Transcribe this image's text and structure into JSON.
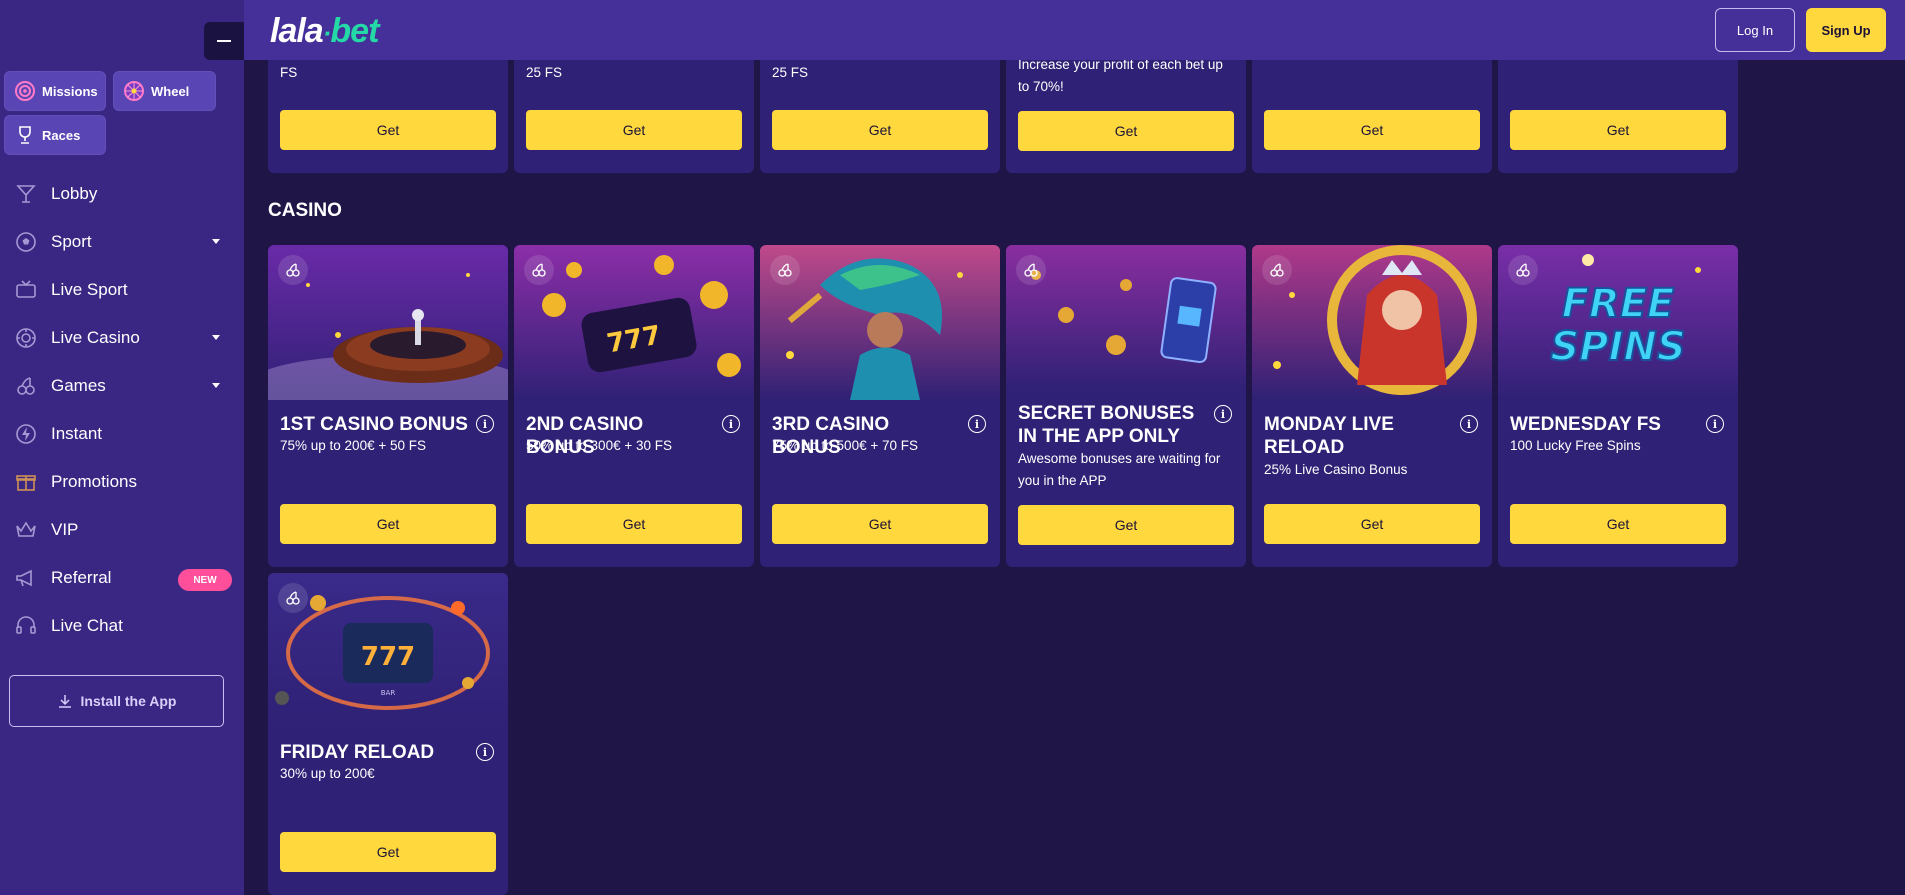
{
  "header": {
    "logo_left": "lala",
    "logo_dot": "·",
    "logo_right": "bet",
    "login_label": "Log In",
    "signup_label": "Sign Up"
  },
  "sidebar": {
    "chips": [
      {
        "label": "Missions",
        "icon": "target-icon"
      },
      {
        "label": "Wheel",
        "icon": "wheel-icon"
      },
      {
        "label": "Races",
        "icon": "trophy-icon"
      }
    ],
    "items": [
      {
        "label": "Lobby",
        "icon": "cocktail-icon"
      },
      {
        "label": "Sport",
        "icon": "football-icon"
      },
      {
        "label": "Live Sport",
        "icon": "live-tv-icon"
      },
      {
        "label": "Live Casino",
        "icon": "chip-icon"
      },
      {
        "label": "Games",
        "icon": "cherries-icon"
      },
      {
        "label": "Instant",
        "icon": "instant-icon"
      },
      {
        "label": "Promotions",
        "icon": "gift-icon"
      },
      {
        "label": "VIP",
        "icon": "crown-icon"
      },
      {
        "label": "Referral",
        "icon": "megaphone-icon",
        "badge": "NEW"
      },
      {
        "label": "Live Chat",
        "icon": "headset-icon"
      }
    ],
    "install_label": "Install the App"
  },
  "top_row": [
    {
      "desc": "FS",
      "button": "Get"
    },
    {
      "desc": "25 FS",
      "button": "Get"
    },
    {
      "desc": "25 FS",
      "button": "Get"
    },
    {
      "desc": "Increase your profit of each bet up to 70%!",
      "button": "Get"
    },
    {
      "desc": "",
      "button": "Get"
    },
    {
      "desc": "",
      "button": "Get"
    }
  ],
  "casino": {
    "section_title": "CASINO",
    "cards": [
      {
        "title": "1ST CASINO BONUS",
        "desc": "75% up to 200€ + 50 FS",
        "button": "Get",
        "info": "i"
      },
      {
        "title": "2ND CASINO BONUS",
        "desc": "50% up to 300€ + 30 FS",
        "button": "Get",
        "info": "i"
      },
      {
        "title": "3RD CASINO BONUS",
        "desc": "75% up to 500€ + 70 FS",
        "button": "Get",
        "info": "i"
      },
      {
        "title": "SECRET BONUSES IN THE APP ONLY",
        "desc": "Awesome bonuses are waiting for you in the APP",
        "button": "Get",
        "info": "i"
      },
      {
        "title": "MONDAY LIVE RELOAD",
        "desc": "25% Live Casino Bonus",
        "button": "Get",
        "info": "i"
      },
      {
        "title": "WEDNESDAY FS",
        "desc": "100 Lucky Free Spins",
        "button": "Get",
        "info": "i",
        "art_text_top": "FREE",
        "art_text_bottom": "SPINS"
      },
      {
        "title": "FRIDAY RELOAD",
        "desc": "30% up to 200€",
        "button": "Get",
        "info": "i",
        "art_text_bottom": "BAR"
      }
    ]
  },
  "colors": {
    "background": "#1f1547",
    "sidebar": "#3a2784",
    "header": "#45309a",
    "card": "#2f2175",
    "accent_yellow": "#ffd83d",
    "logo_green": "#25d9a6",
    "badge_pink": "#ff4f9a"
  }
}
